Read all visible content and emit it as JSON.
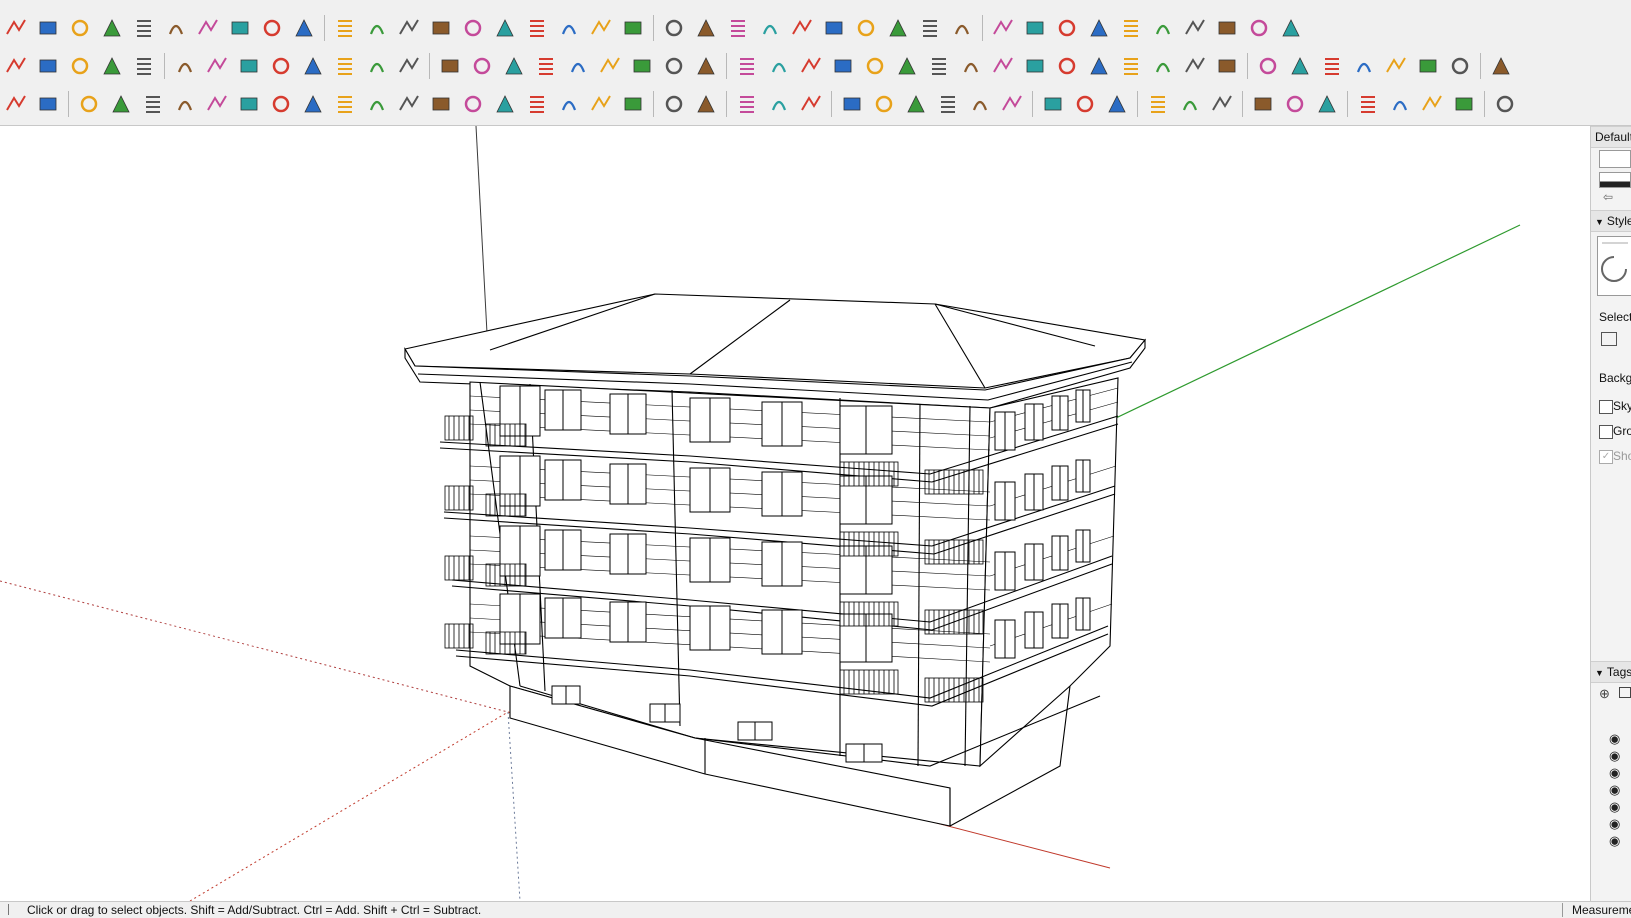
{
  "toolbar": {
    "row1_icons": [
      "line-icon",
      "eraser-icon",
      "select-icon",
      "move-icon",
      "rotate-icon",
      "follow-me-icon",
      "push-pull-icon",
      "offset-icon",
      "scale-icon",
      "arc-icon",
      "fillet-icon",
      "chamfer-icon",
      "sweep-icon",
      "extrude-icon",
      "cut-icon",
      "grid-icon",
      "joint-icon",
      "hand-icon",
      "paint-icon",
      "shell-icon",
      "stair-icon",
      "slice-icon",
      "split-icon",
      "fold-icon",
      "roof-icon",
      "lathe-icon",
      "weld-icon",
      "flip-icon",
      "mirror-icon",
      "frame-icon",
      "window-icon",
      "wall-icon",
      "hatch-icon",
      "railing-icon",
      "column-icon",
      "sphere-icon",
      "tube-icon",
      "array-icon",
      "curve-icon",
      "loft-icon"
    ],
    "row2_icons": [
      "plane-blue-icon",
      "plane-yellow-icon",
      "plane-green-icon",
      "plane-red-icon",
      "plane-white-icon",
      "rotate-orange-icon",
      "stop-icon",
      "list-icon",
      "flag-icon",
      "box-icon",
      "pipe-icon",
      "bend-icon",
      "points-icon",
      "add-red-icon",
      "add-green-icon",
      "cross-blue-icon",
      "cone-icon",
      "drop-icon",
      "triangle-icon",
      "loop-icon",
      "loop-alt-icon",
      "spin-icon",
      "move-cross-icon",
      "cube-icon",
      "undo-red-icon",
      "tree-icon",
      "export-icon",
      "group-icon",
      "ungroup-icon",
      "paint-bucket-icon",
      "component-icon",
      "frame-blue-icon",
      "grid-yellow-icon",
      "grid-orange-icon",
      "grid-gold-icon",
      "explode-icon",
      "spline-icon",
      "snap-icon",
      "pencil-icon",
      "dimension-icon",
      "paint-brush-icon",
      "section-icon",
      "section-alt-icon",
      "section-blue-icon",
      "swirl-icon",
      "scale-balance-icon"
    ],
    "row3_icons": [
      "magnet-icon",
      "solid-icon",
      "arc-tool-icon",
      "polyline-icon",
      "zigzag-icon",
      "wave-icon",
      "bezier-icon",
      "arc-green-icon",
      "rectangle-icon",
      "spiral-icon",
      "arc-open-icon",
      "zigzag-green-icon",
      "hook-icon",
      "arc-small-icon",
      "arc-red-icon",
      "polyline-blue-icon",
      "polygon-icon",
      "wrench-icon",
      "circle-red-icon",
      "triangle-red-icon",
      "layers-icon",
      "terrain-icon",
      "select-arrow-icon",
      "zoom-extents-icon",
      "zoom-window-icon",
      "align-left-icon",
      "align-center-icon",
      "align-right-icon",
      "distribute-icon",
      "distribute-plus-icon",
      "distribute-minus-icon",
      "section-plane-icon",
      "section-grid-icon",
      "section-hatch-icon",
      "table-icon",
      "table-blue-icon",
      "table-cross-icon",
      "mesh-icon",
      "mesh-hatch-icon",
      "house-icon",
      "checker-icon",
      "copy-icon",
      "paste-icon",
      "move-blue-icon",
      "panel-icon"
    ]
  },
  "tray": {
    "default_label": "Default",
    "styles_header": "Styles",
    "select_label": "Select",
    "background_label": "Background",
    "checkboxes": [
      {
        "label": "Sky",
        "checked": false,
        "enabled": true
      },
      {
        "label": "Ground",
        "checked": false,
        "enabled": true
      },
      {
        "label": "Show",
        "checked": true,
        "enabled": false
      }
    ],
    "tags_header": "Tags",
    "tag_rows": 7
  },
  "status": {
    "message": "Click or drag to select objects. Shift = Add/Subtract. Ctrl = Add. Shift + Ctrl = Subtract.",
    "measurements_label": "Measurements"
  },
  "colors": {
    "axis_red": "#c0392b",
    "axis_green": "#2e9a2e",
    "axis_blue": "#6b7a99",
    "model_line": "#000000"
  }
}
